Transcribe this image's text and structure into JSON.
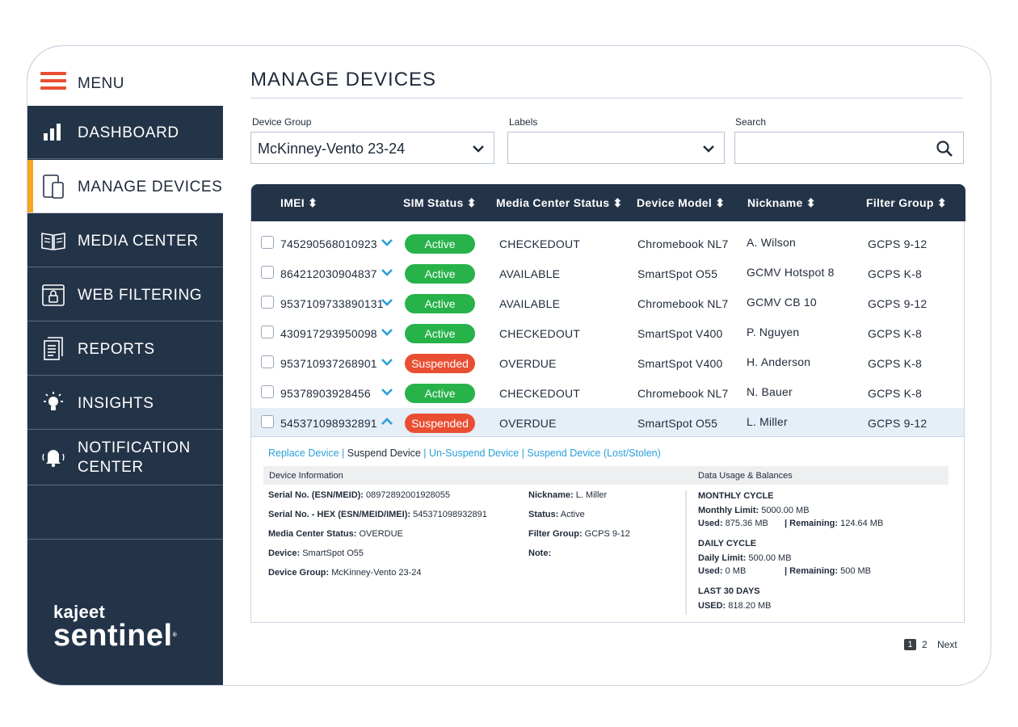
{
  "sidebar": {
    "menu_label": "MENU",
    "items": [
      {
        "label": "DASHBOARD",
        "icon": "bar-chart-icon"
      },
      {
        "label": "MANAGE DEVICES",
        "icon": "devices-icon",
        "active": true
      },
      {
        "label": "MEDIA CENTER",
        "icon": "book-icon"
      },
      {
        "label": "WEB FILTERING",
        "icon": "browser-lock-icon"
      },
      {
        "label": "REPORTS",
        "icon": "document-icon"
      },
      {
        "label": "INSIGHTS",
        "icon": "lightbulb-icon"
      },
      {
        "label_line1": "NOTIFICATION",
        "label_line2": "CENTER",
        "icon": "bell-icon"
      }
    ],
    "logo_top": "kajeet",
    "logo_bottom": "sentinel",
    "logo_mark": "®"
  },
  "page": {
    "title": "MANAGE DEVICES"
  },
  "filters": {
    "device_group_label": "Device Group",
    "device_group_value": "McKinney-Vento 23-24",
    "labels_label": "Labels",
    "labels_value": "",
    "search_label": "Search",
    "search_value": ""
  },
  "table": {
    "headers": [
      "IMEI ⬍",
      "SIM Status ⬍",
      "Media Center Status ⬍",
      "Device Model ⬍",
      "Nickname ⬍",
      "Filter Group ⬍"
    ],
    "rows": [
      {
        "imei": "745290568010923",
        "sim": "Active",
        "media": "CHECKEDOUT",
        "model": "Chromebook NL7",
        "nickname": "A. Wilson",
        "filter": "GCPS 9-12"
      },
      {
        "imei": "864212030904837",
        "sim": "Active",
        "media": "AVAILABLE",
        "model": "SmartSpot O55",
        "nickname": "GCMV Hotspot 8",
        "filter": "GCPS K-8"
      },
      {
        "imei": "9537109733890131",
        "sim": "Active",
        "media": "AVAILABLE",
        "model": "Chromebook NL7",
        "nickname": "GCMV CB 10",
        "filter": "GCPS 9-12"
      },
      {
        "imei": "430917293950098",
        "sim": "Active",
        "media": "CHECKEDOUT",
        "model": "SmartSpot V400",
        "nickname": "P. Nguyen",
        "filter": "GCPS K-8"
      },
      {
        "imei": "953710937268901",
        "sim": "Suspended",
        "media": "OVERDUE",
        "model": "SmartSpot V400",
        "nickname": "H. Anderson",
        "filter": "GCPS K-8"
      },
      {
        "imei": "95378903928456",
        "sim": "Active",
        "media": "CHECKEDOUT",
        "model": "Chromebook NL7",
        "nickname": "N. Bauer",
        "filter": "GCPS K-8"
      },
      {
        "imei": "545371098932891",
        "sim": "Suspended",
        "media": "OVERDUE",
        "model": "SmartSpot O55",
        "nickname": "L. Miller",
        "filter": "GCPS 9-12"
      }
    ]
  },
  "detail": {
    "actions": {
      "replace": "Replace Device",
      "suspend": "Suspend Device",
      "unsuspend": "Un-Suspend Device",
      "lost": "Suspend Device (Lost/Stolen)",
      "sep": "|"
    },
    "device_info_title": "Device Information",
    "data_usage_title": "Data Usage & Balances",
    "serial_label": "Serial No. (ESN/MEID):",
    "serial_value": "08972892001928055",
    "serial_hex_label": "Serial No. - HEX (ESN/MEID/IMEI):",
    "serial_hex_value": "545371098932891",
    "media_label": "Media Center Status:",
    "media_value": "OVERDUE",
    "device_label": "Device:",
    "device_value": "SmartSpot O55",
    "group_label": "Device Group:",
    "group_value": "McKinney-Vento 23-24",
    "nickname_label": "Nickname:",
    "nickname_value": "L. Miller",
    "status_label": "Status:",
    "status_value": "Active",
    "filter_label": "Filter Group:",
    "filter_value": "GCPS 9-12",
    "note_label": "Note:",
    "monthly_head": "MONTHLY CYCLE",
    "monthly_limit_label": "Monthly Limit:",
    "monthly_limit_value": "5000.00 MB",
    "monthly_used_label": "Used:",
    "monthly_used_value": "875.36 MB",
    "monthly_rem_label": "| Remaining:",
    "monthly_rem_value": "124.64 MB",
    "daily_head": "DAILY CYCLE",
    "daily_limit_label": "Daily Limit:",
    "daily_limit_value": "500.00 MB",
    "daily_used_label": "Used:",
    "daily_used_value": "0 MB",
    "daily_rem_label": "| Remaining:",
    "daily_rem_value": "500 MB",
    "last30_head": "LAST 30 DAYS",
    "last30_label": "USED:",
    "last30_value": "818.20 MB"
  },
  "pagination": {
    "page1": "1",
    "page2": "2",
    "next": "Next"
  },
  "colors": {
    "navy": "#243448",
    "active_green": "#27b24a",
    "suspended_red": "#e94e32",
    "accent_orange": "#f6a623",
    "link_blue": "#2a9fd8"
  }
}
